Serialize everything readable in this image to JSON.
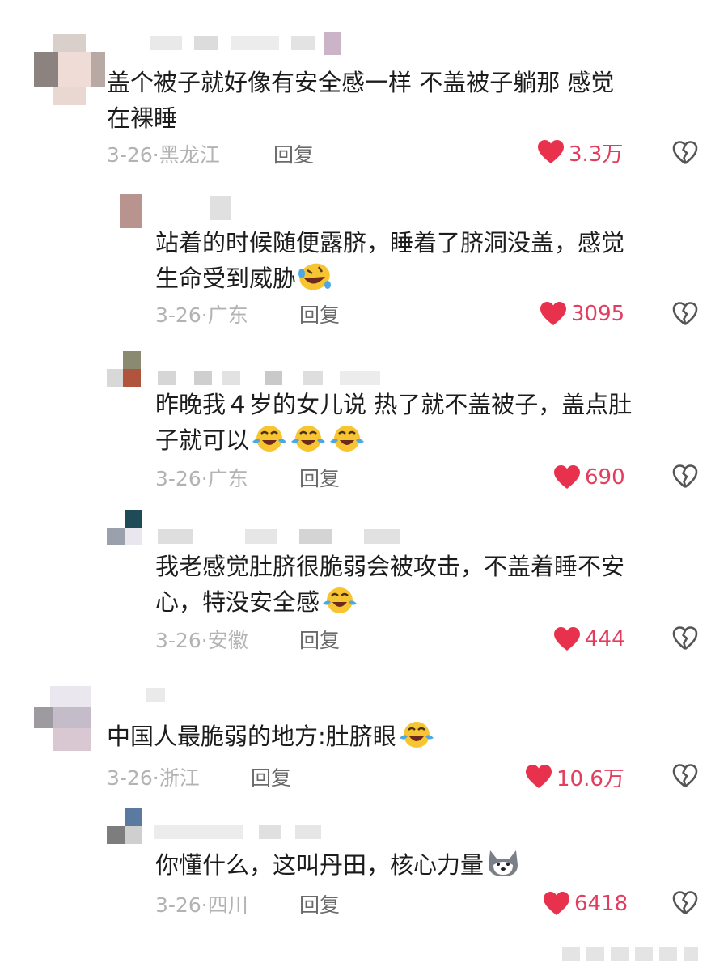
{
  "comments": [
    {
      "text_line1": "盖个被子就好像有安全感一样  不盖被子躺那 感觉",
      "text_line2": "在裸睡",
      "date": "3-26",
      "region": "黑龙江",
      "reply_label": "回复",
      "likes": "3.3万"
    },
    {
      "text_line1": "站着的时候随便露脐，睡着了脐洞没盖，感觉",
      "text_line2": "生命受到威胁",
      "emoji": "rolling-laugh-emoji",
      "date": "3-26",
      "region": "广东",
      "reply_label": "回复",
      "likes": "3095"
    },
    {
      "text_line1": "昨晚我４岁的女儿说 热了就不盖被子，盖点肚",
      "text_line2": "子就可以",
      "emoji": "crying-laugh-emoji",
      "date": "3-26",
      "region": "广东",
      "reply_label": "回复",
      "likes": "690"
    },
    {
      "text_line1": "我老感觉肚脐很脆弱会被攻击，不盖着睡不安",
      "text_line2": "心，特没安全感",
      "emoji": "crying-laugh-emoji",
      "date": "3-26",
      "region": "安徽",
      "reply_label": "回复",
      "likes": "444"
    },
    {
      "text_line1": "中国人最脆弱的地方:肚脐眼",
      "emoji": "crying-laugh-emoji",
      "date": "3-26",
      "region": "浙江",
      "reply_label": "回复",
      "likes": "10.6万"
    },
    {
      "text_line1": "你懂什么，这叫丹田，核心力量",
      "emoji": "husky-dog-emoji",
      "date": "3-26",
      "region": "四川",
      "reply_label": "回复",
      "likes": "6418"
    }
  ],
  "meta_separator": "·",
  "colors": {
    "heart": "#e8324d",
    "like_count": "#e23d5e",
    "meta_gray": "#b3b3b3",
    "reply_gray": "#6a6a6a",
    "dislike_gray": "#555555"
  },
  "icons": {
    "like": "heart-icon",
    "dislike": "broken-heart-icon"
  }
}
